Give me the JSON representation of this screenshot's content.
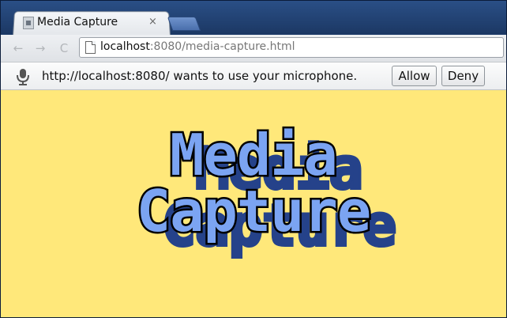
{
  "tab": {
    "title": "Media Capture",
    "close_glyph": "×",
    "favicon": "page-favicon"
  },
  "toolbar": {
    "back_icon": "arrow-left-icon",
    "forward_icon": "arrow-right-icon",
    "reload_icon": "reload-icon",
    "back_glyph": "←",
    "forward_glyph": "→",
    "reload_glyph": "C",
    "url_host": "localhost",
    "url_rest": ":8080/media-capture.html"
  },
  "infobar": {
    "icon": "microphone-icon",
    "message": "http://localhost:8080/ wants to use your microphone.",
    "allow_label": "Allow",
    "deny_label": "Deny"
  },
  "page": {
    "heading_line1": "Media",
    "heading_line2": "Capture",
    "background_color": "#ffe87a",
    "text_color": "#7ba4f2",
    "shadow_color": "#25428a"
  }
}
